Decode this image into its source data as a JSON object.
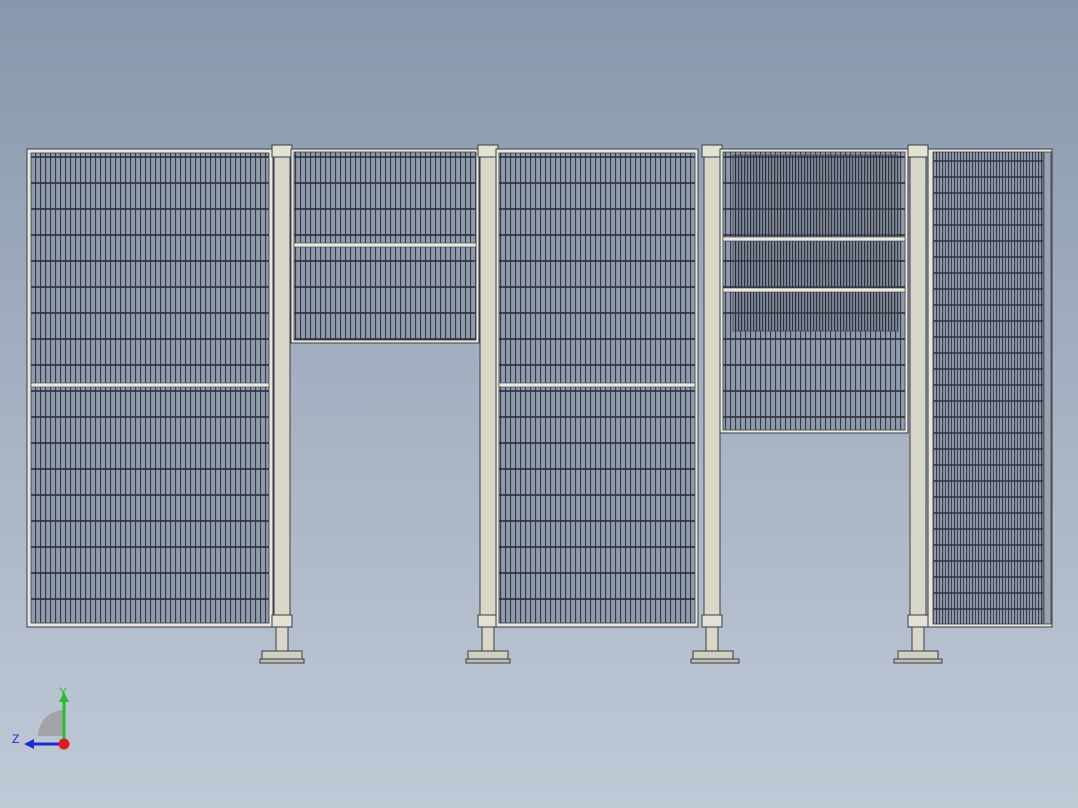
{
  "viewport": {
    "background_top": "#8797ad",
    "background_bottom": "#c0c9d6"
  },
  "model": {
    "frame_color": "#e6e6dc",
    "post_color": "#d8d7c8",
    "mesh_line_color": "#2b2f38",
    "mesh_fill": "#8e99ab"
  },
  "triad": {
    "y_label": "Y",
    "z_label": "Z",
    "y_color": "#22c22a",
    "z_color": "#1a2bd6",
    "x_color": "#e01b1b"
  }
}
